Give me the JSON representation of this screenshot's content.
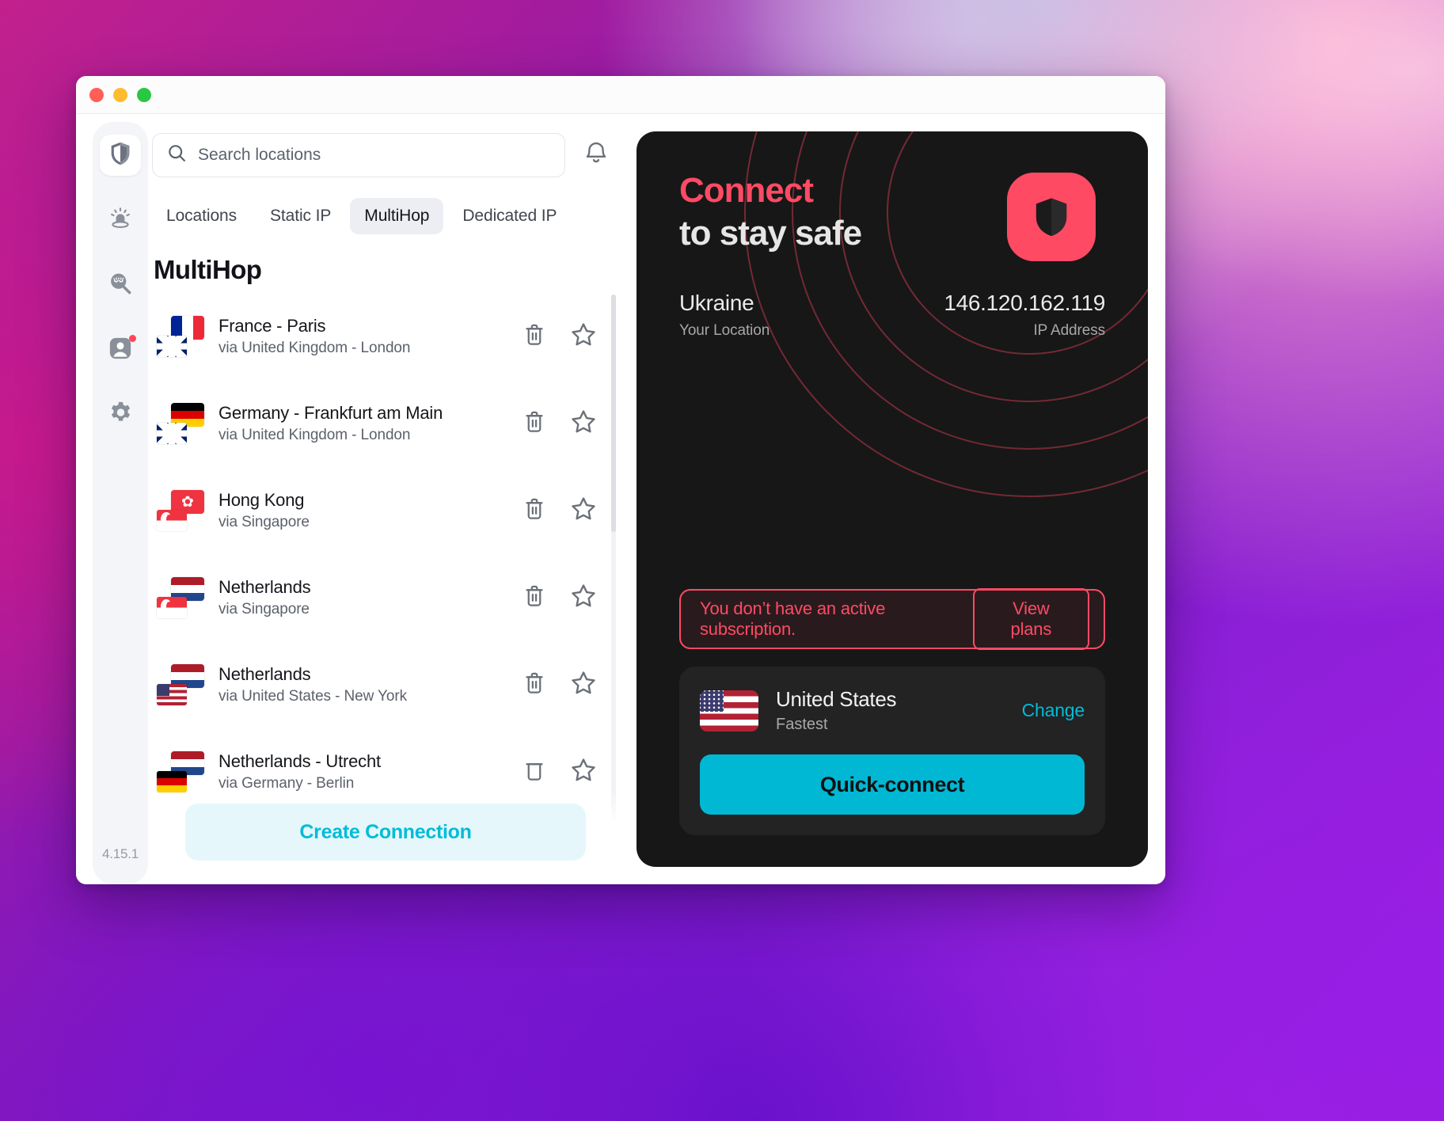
{
  "window": {
    "traffic_lights": [
      "close",
      "minimize",
      "maximize"
    ],
    "version": "4.15.1"
  },
  "sidebar": {
    "items": [
      {
        "name": "shield-icon",
        "label": "Protection",
        "active": true,
        "badge": false
      },
      {
        "name": "alarm-icon",
        "label": "Alerts",
        "active": false,
        "badge": false
      },
      {
        "name": "scan-icon",
        "label": "Data breach scanner",
        "active": false,
        "badge": false
      },
      {
        "name": "account-icon",
        "label": "Account",
        "active": false,
        "badge": true
      },
      {
        "name": "gear-icon",
        "label": "Settings",
        "active": false,
        "badge": false
      }
    ]
  },
  "search": {
    "placeholder": "Search locations",
    "value": "",
    "icon": "search-icon"
  },
  "notifications": {
    "icon": "bell-icon"
  },
  "tabs": [
    {
      "label": "Locations",
      "selected": false
    },
    {
      "label": "Static IP",
      "selected": false
    },
    {
      "label": "MultiHop",
      "selected": true
    },
    {
      "label": "Dedicated IP",
      "selected": false
    }
  ],
  "list": {
    "heading": "MultiHop",
    "rows": [
      {
        "title": "France - Paris",
        "subtitle": "via United Kingdom - London",
        "flag_main": "fr",
        "flag_sub": "gb",
        "delete_icon": "trash-icon",
        "favorite_icon": "star-icon"
      },
      {
        "title": "Germany - Frankfurt am Main",
        "subtitle": "via United Kingdom - London",
        "flag_main": "de",
        "flag_sub": "gb",
        "delete_icon": "trash-icon",
        "favorite_icon": "star-icon"
      },
      {
        "title": "Hong Kong",
        "subtitle": "via Singapore",
        "flag_main": "hk",
        "flag_sub": "sg",
        "delete_icon": "trash-icon",
        "favorite_icon": "star-icon"
      },
      {
        "title": "Netherlands",
        "subtitle": "via Singapore",
        "flag_main": "nl",
        "flag_sub": "sg",
        "delete_icon": "trash-icon",
        "favorite_icon": "star-icon"
      },
      {
        "title": "Netherlands",
        "subtitle": "via United States - New York",
        "flag_main": "nl",
        "flag_sub": "us",
        "delete_icon": "trash-icon",
        "favorite_icon": "star-icon"
      },
      {
        "title": "Netherlands - Utrecht",
        "subtitle": "via Germany - Berlin",
        "flag_main": "nl",
        "flag_sub": "de",
        "delete_icon": "trash-icon",
        "favorite_icon": "star-icon"
      }
    ]
  },
  "create_connection": {
    "label": "Create Connection"
  },
  "connect_card": {
    "headline_top": "Connect",
    "headline_bottom": "to stay safe",
    "logo_icon": "shield-logo-icon",
    "location_value": "Ukraine",
    "location_label": "Your Location",
    "ip_value": "146.120.162.119",
    "ip_label": "IP Address",
    "accent_color": "#ff4a64",
    "card_background": "#171717"
  },
  "subscription_banner": {
    "message": "You don’t have an active subscription.",
    "button_label": "View plans",
    "color": "#ff4a64"
  },
  "quick_connect": {
    "flag": "us",
    "country": "United States",
    "speed_label": "Fastest",
    "change_label": "Change",
    "button_label": "Quick-connect",
    "button_color": "#00b8d4"
  }
}
